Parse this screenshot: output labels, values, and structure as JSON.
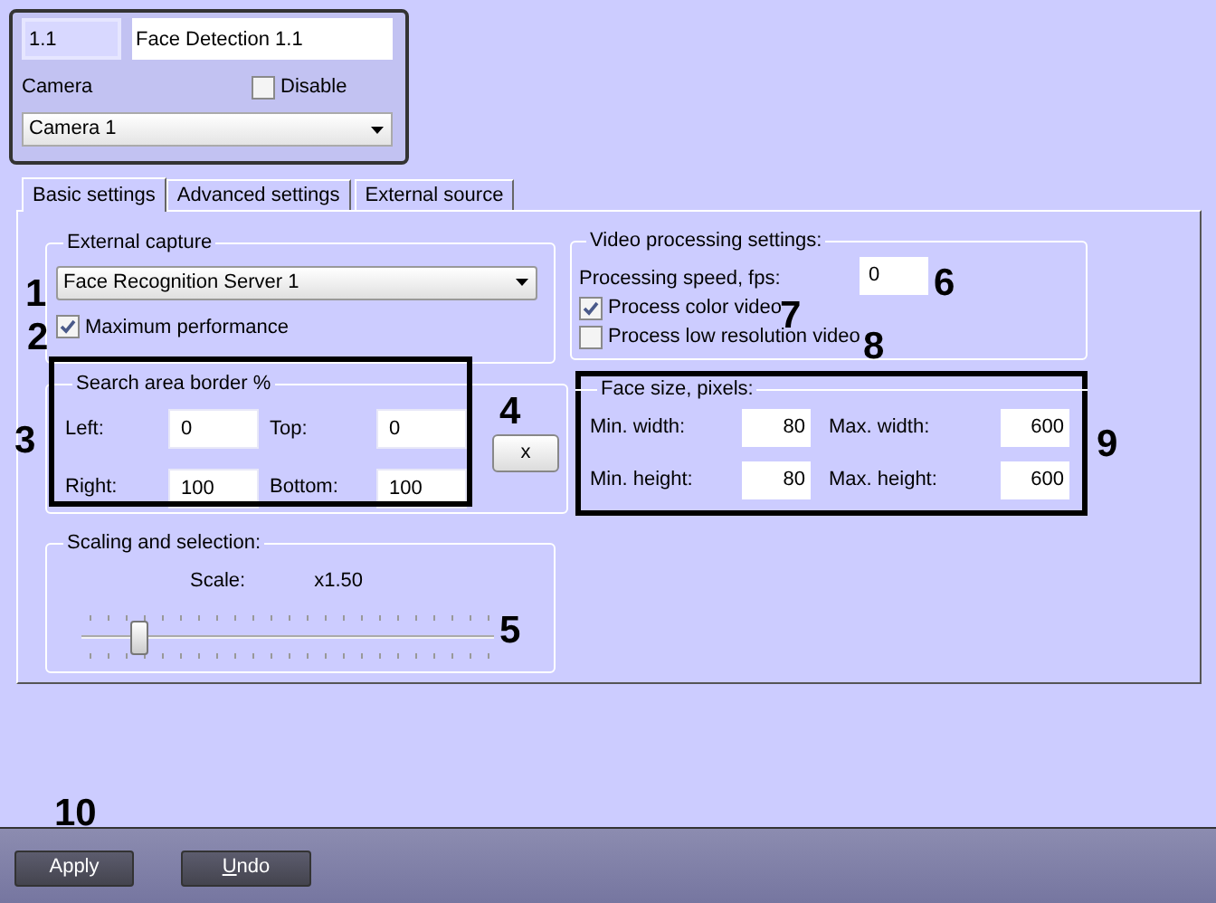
{
  "header": {
    "id": "1.1",
    "name": "Face Detection 1.1",
    "camera_label": "Camera",
    "disable": {
      "label": "Disable",
      "checked": false
    },
    "camera": "Camera 1"
  },
  "tabs": [
    {
      "label": "Basic settings",
      "selected": true
    },
    {
      "label": "Advanced settings",
      "selected": false
    },
    {
      "label": "External source",
      "selected": false
    }
  ],
  "external_capture": {
    "title": "External capture",
    "server": "Face Recognition Server 1",
    "max_perf": {
      "label": "Maximum performance",
      "checked": true
    }
  },
  "search_area": {
    "title": "Search area border %",
    "fields": [
      {
        "label": "Left:",
        "value": "0"
      },
      {
        "label": "Top:",
        "value": "0"
      },
      {
        "label": "Right:",
        "value": "100"
      },
      {
        "label": "Bottom:",
        "value": "100"
      }
    ]
  },
  "reset_button": "x",
  "scaling": {
    "title": "Scaling and selection:",
    "scale_label": "Scale:",
    "scale_value": "x1.50",
    "level": 0.14
  },
  "video": {
    "title": "Video processing settings:",
    "speed_label": "Processing speed, fps:",
    "speed": "0",
    "options": [
      {
        "label": "Process color video",
        "checked": true
      },
      {
        "label": "Process low resolution video",
        "checked": false
      }
    ]
  },
  "face_size": {
    "title": "Face size, pixels:",
    "fields": [
      {
        "label": "Min. width:",
        "value": "80"
      },
      {
        "label": "Max. width:",
        "value": "600"
      },
      {
        "label": "Min. height:",
        "value": "80"
      },
      {
        "label": "Max. height:",
        "value": "600"
      }
    ]
  },
  "callouts": [
    "1",
    "2",
    "3",
    "4",
    "5",
    "6",
    "7",
    "8",
    "9",
    "10"
  ],
  "buttons": [
    {
      "label": "Apply"
    },
    {
      "accel": "U",
      "rest": "ndo"
    }
  ]
}
